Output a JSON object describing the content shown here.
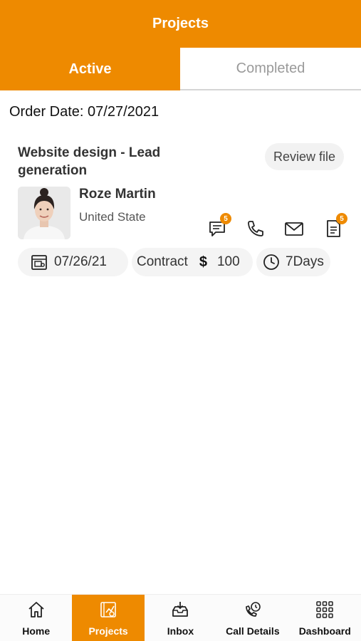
{
  "header": {
    "title": "Projects"
  },
  "tabs": [
    {
      "label": "Active"
    },
    {
      "label": "Completed"
    }
  ],
  "order": {
    "date_label": "Order Date: 07/27/2021"
  },
  "project": {
    "title": "Website design - Lead generation",
    "review_label": "Review file",
    "client_name": "Roze Martin",
    "client_location": "United State",
    "messages_badge": "5",
    "files_badge": "5",
    "date": "07/26/21",
    "type": "Contract",
    "currency": "$",
    "amount": "100",
    "duration": "7Days"
  },
  "colors": {
    "accent": "#ee8a00"
  },
  "icons": [
    "message-icon",
    "phone-icon",
    "mail-icon",
    "document-icon",
    "calendar-icon",
    "clock-icon"
  ],
  "bottom_nav": [
    {
      "label": "Home",
      "icon": "home-icon"
    },
    {
      "label": "Projects",
      "icon": "projects-icon"
    },
    {
      "label": "Inbox",
      "icon": "inbox-icon"
    },
    {
      "label": "Call Details",
      "icon": "call-details-icon"
    },
    {
      "label": "Dashboard",
      "icon": "dashboard-icon"
    }
  ]
}
